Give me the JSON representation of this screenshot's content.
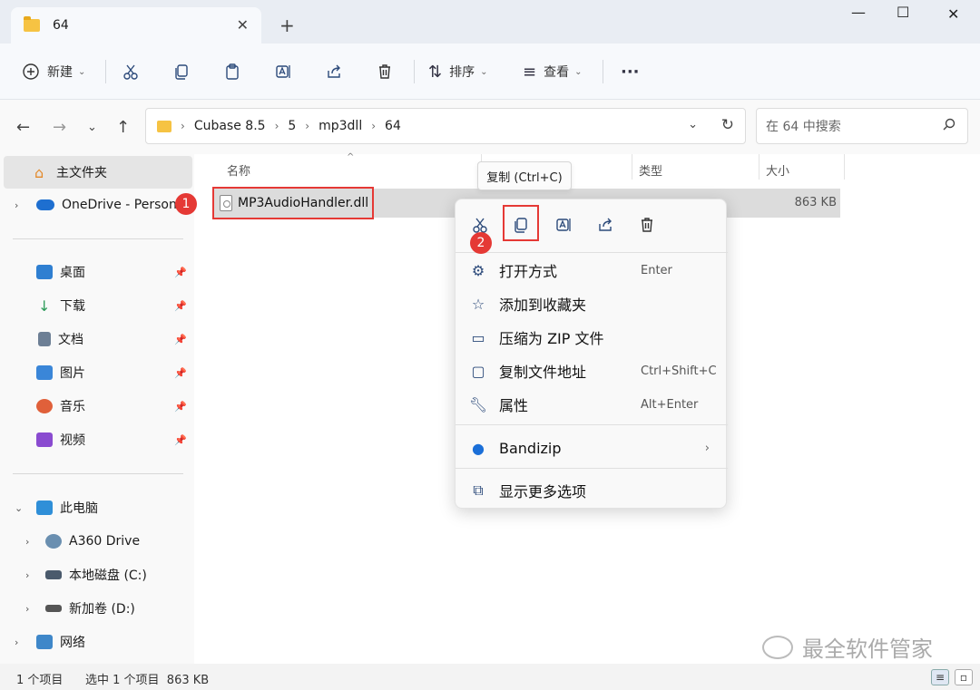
{
  "window": {
    "tab_title": "64",
    "tab_close": "✕",
    "new_tab": "+",
    "minimize": "—",
    "maximize": "☐",
    "close": "✕"
  },
  "toolbar": {
    "new_label": "新建",
    "sort_label": "排序",
    "view_label": "查看",
    "more": "···"
  },
  "address": {
    "crumbs": [
      "Cubase 8.5",
      "5",
      "mp3dll",
      "64"
    ],
    "crumb_sep": "›",
    "search_placeholder": "在 64 中搜索"
  },
  "sidebar": {
    "home": "主文件夹",
    "onedrive": "OneDrive - Persona",
    "quick": [
      {
        "label": "桌面",
        "color": "#2f7fd1"
      },
      {
        "label": "下载",
        "color": "#2b9a58"
      },
      {
        "label": "文档",
        "color": "#6d7f95"
      },
      {
        "label": "图片",
        "color": "#3a86d8"
      },
      {
        "label": "音乐",
        "color": "#e0603a"
      },
      {
        "label": "视频",
        "color": "#8a4bd0"
      }
    ],
    "this_pc": "此电脑",
    "drives": [
      "A360 Drive",
      "本地磁盘 (C:)",
      "新加卷 (D:)"
    ],
    "network": "网络"
  },
  "columns": {
    "name": "名称",
    "type": "类型",
    "size": "大小"
  },
  "file": {
    "name": "MP3AudioHandler.dll",
    "size": "863 KB"
  },
  "badges": {
    "one": "1",
    "two": "2"
  },
  "tooltip": "复制 (Ctrl+C)",
  "context_menu": {
    "items": [
      {
        "icon": "open-with-icon",
        "label": "打开方式",
        "shortcut": "Enter"
      },
      {
        "icon": "star-icon",
        "label": "添加到收藏夹",
        "shortcut": ""
      },
      {
        "icon": "zip-icon",
        "label": "压缩为 ZIP 文件",
        "shortcut": ""
      },
      {
        "icon": "copy-path-icon",
        "label": "复制文件地址",
        "shortcut": "Ctrl+Shift+C"
      },
      {
        "icon": "wrench-icon",
        "label": "属性",
        "shortcut": "Alt+Enter"
      }
    ],
    "bandizip": "Bandizip",
    "more_options": "显示更多选项"
  },
  "status": {
    "count": "1 个项目",
    "selection": "选中 1 个项目  863 KB"
  },
  "watermark": "最全软件管家",
  "colors": {
    "highlight_red": "#e53935",
    "folder_yellow": "#f6c343"
  }
}
